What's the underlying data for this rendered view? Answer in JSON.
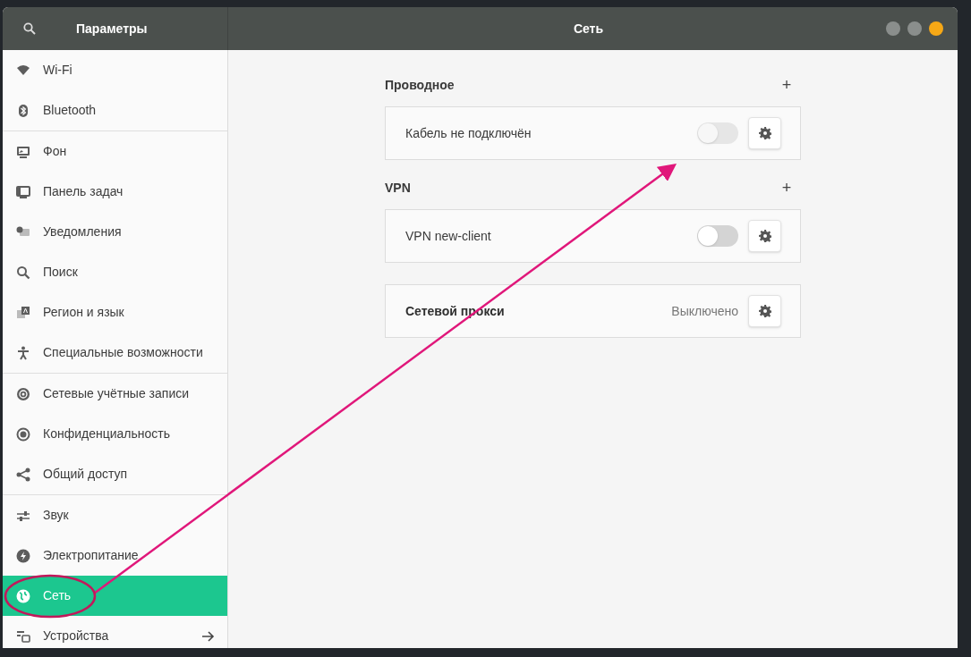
{
  "window": {
    "sidebar_title": "Параметры",
    "title": "Сеть"
  },
  "sidebar": {
    "groups": [
      {
        "items": [
          {
            "label": "Wi-Fi",
            "selected": false,
            "submenu": false
          },
          {
            "label": "Bluetooth",
            "selected": false,
            "submenu": false
          }
        ]
      },
      {
        "items": [
          {
            "label": "Фон",
            "selected": false,
            "submenu": false
          },
          {
            "label": "Панель задач",
            "selected": false,
            "submenu": false
          },
          {
            "label": "Уведомления",
            "selected": false,
            "submenu": false
          },
          {
            "label": "Поиск",
            "selected": false,
            "submenu": false
          },
          {
            "label": "Регион и язык",
            "selected": false,
            "submenu": false
          },
          {
            "label": "Специальные возможности",
            "selected": false,
            "submenu": false
          }
        ]
      },
      {
        "items": [
          {
            "label": "Сетевые учётные записи",
            "selected": false,
            "submenu": false
          },
          {
            "label": "Конфиденциальность",
            "selected": false,
            "submenu": false
          },
          {
            "label": "Общий доступ",
            "selected": false,
            "submenu": false
          }
        ]
      },
      {
        "items": [
          {
            "label": "Звук",
            "selected": false,
            "submenu": false
          },
          {
            "label": "Электропитание",
            "selected": false,
            "submenu": false
          },
          {
            "label": "Сеть",
            "selected": true,
            "submenu": false
          },
          {
            "label": "Устройства",
            "selected": false,
            "submenu": true
          }
        ]
      }
    ]
  },
  "sections": [
    {
      "title": "Проводное",
      "add_label": "+",
      "rows": [
        {
          "kind": "toggle",
          "label": "Кабель не подключён",
          "on": false,
          "disabled": true
        }
      ]
    },
    {
      "title": "VPN",
      "add_label": "+",
      "rows": [
        {
          "kind": "toggle",
          "label": "VPN new-client",
          "on": false,
          "disabled": false
        }
      ]
    },
    {
      "rows": [
        {
          "kind": "status",
          "label": "Сетевой прокси",
          "value": "Выключено"
        }
      ]
    }
  ]
}
